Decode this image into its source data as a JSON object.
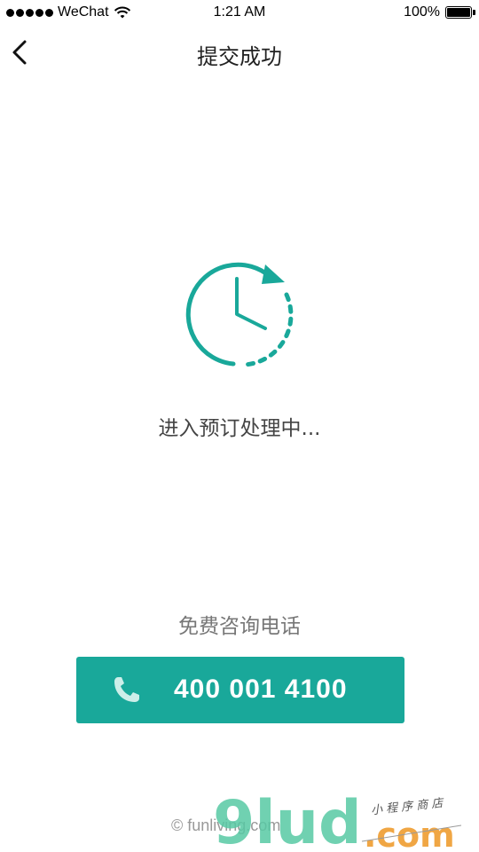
{
  "status_bar": {
    "carrier": "WeChat",
    "time": "1:21 AM",
    "battery": "100%"
  },
  "nav": {
    "title": "提交成功"
  },
  "main": {
    "status_text": "进入预订处理中...",
    "hotline_label": "免费咨询电话",
    "phone_number": "400 001 4100"
  },
  "footer": {
    "copyright": "© funliving.com"
  },
  "watermark": {
    "logo_text": "9lud",
    "domain": ".com",
    "tagline": "小程序商店"
  },
  "colors": {
    "accent": "#19a89a",
    "watermark_green": "#58c9a4",
    "watermark_orange": "#f0a23a"
  },
  "icons": [
    "back-arrow-icon",
    "clock-refresh-icon",
    "phone-icon",
    "wifi-icon",
    "battery-icon"
  ]
}
